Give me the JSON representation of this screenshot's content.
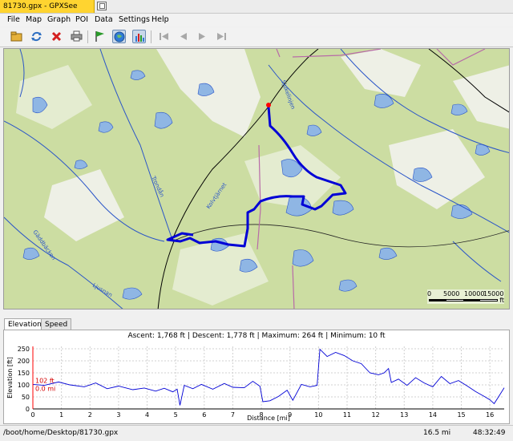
{
  "window": {
    "title": "81730.gpx - GPXSee"
  },
  "menu": {
    "items": [
      "File",
      "Map",
      "Graph",
      "POI",
      "Data",
      "Settings",
      "Help"
    ]
  },
  "toolbar": {
    "buttons": [
      "open-icon",
      "reload-icon",
      "close-icon",
      "print-icon",
      "show-waypoints-icon",
      "show-map-icon",
      "show-graphs-icon",
      "first-file-icon",
      "prev-file-icon",
      "next-file-icon",
      "last-file-icon"
    ]
  },
  "map": {
    "scale": {
      "ticks": [
        "0",
        "5000",
        "10000",
        "15000"
      ],
      "unit": "ft"
    },
    "labels": [
      "Sjukelinjen",
      "Trondån",
      "Gäddbäcken",
      "Ljusnan",
      "Kolvtjärnet"
    ]
  },
  "tabs": [
    "Elevation",
    "Speed"
  ],
  "graph": {
    "info": "Ascent: 1,768 ft  |  Descent: 1,778 ft  |  Maximum: 264 ft  |  Minimum: 10 ft",
    "marker": {
      "value": "102 ft",
      "position": "0.0 mi"
    },
    "y_label": "Elevation [ft]",
    "x_label": "Distance [mi]",
    "y_ticks": [
      "0",
      "50",
      "100",
      "150",
      "200",
      "250"
    ],
    "x_ticks": [
      "0",
      "1",
      "2",
      "3",
      "4",
      "5",
      "6",
      "7",
      "8",
      "9",
      "10",
      "11",
      "12",
      "13",
      "14",
      "15",
      "16"
    ]
  },
  "chart_data": {
    "type": "line",
    "xlabel": "Distance [mi]",
    "ylabel": "Elevation [ft]",
    "xlim": [
      0,
      16.5
    ],
    "ylim": [
      0,
      260
    ],
    "grid": true,
    "series": [
      {
        "x": [
          0,
          0.4,
          0.9,
          1.3,
          1.8,
          2.2,
          2.6,
          3.0,
          3.5,
          3.9,
          4.3,
          4.6,
          4.9,
          5.05,
          5.15,
          5.3,
          5.6,
          5.9,
          6.3,
          6.7,
          7.0,
          7.4,
          7.7,
          7.95,
          8.05,
          8.3,
          8.6,
          8.9,
          9.1,
          9.4,
          9.7,
          9.95,
          10.05,
          10.3,
          10.6,
          10.9,
          11.2,
          11.5,
          11.8,
          12.1,
          12.3,
          12.45,
          12.55,
          12.8,
          13.1,
          13.4,
          13.7,
          14.0,
          14.3,
          14.6,
          14.9,
          15.2,
          15.5,
          15.8,
          16.0,
          16.15,
          16.3,
          16.5
        ],
        "values": [
          102,
          98,
          112,
          100,
          92,
          108,
          84,
          95,
          80,
          87,
          74,
          86,
          71,
          82,
          15,
          98,
          84,
          102,
          82,
          106,
          90,
          88,
          115,
          94,
          30,
          34,
          52,
          78,
          36,
          102,
          92,
          98,
          248,
          218,
          235,
          222,
          200,
          188,
          150,
          142,
          150,
          168,
          110,
          124,
          98,
          130,
          108,
          92,
          135,
          105,
          118,
          96,
          72,
          52,
          38,
          22,
          50,
          88
        ]
      }
    ]
  }
}
